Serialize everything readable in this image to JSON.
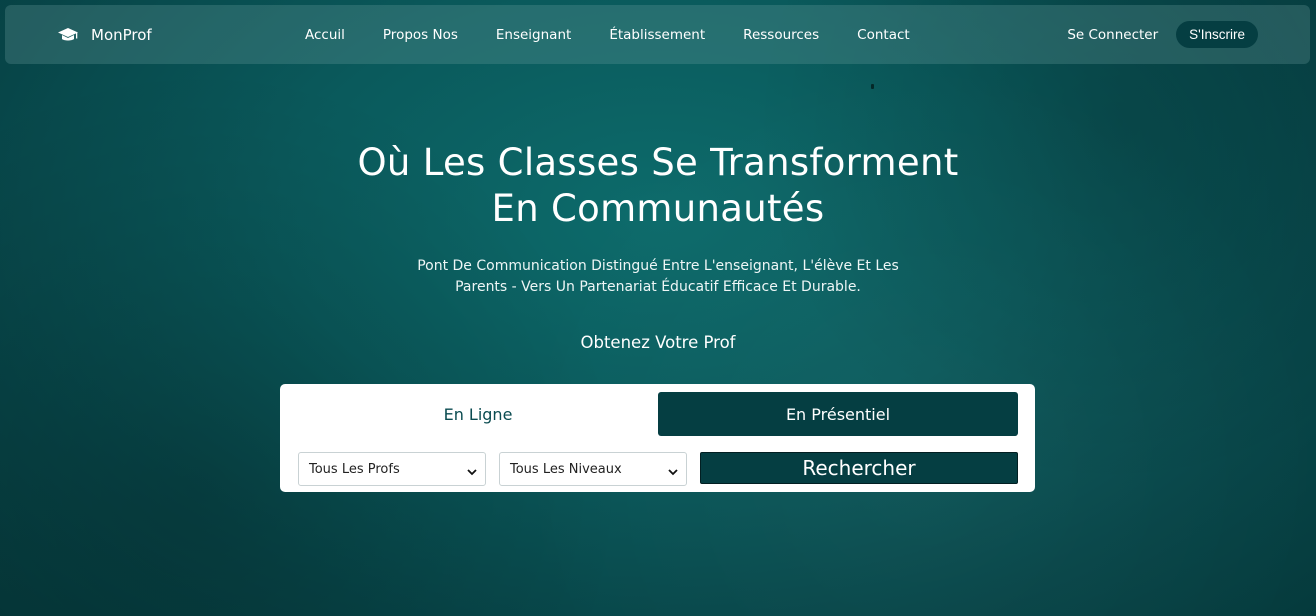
{
  "brand": {
    "name": "MonProf",
    "icon": "graduation-cap-icon"
  },
  "nav": {
    "links": [
      "Accuil",
      "Propos Nos",
      "Enseignant",
      "Établissement",
      "Ressources",
      "Contact"
    ],
    "login_label": "Se Connecter",
    "signup_label": "S'Inscrire"
  },
  "hero": {
    "title_line1": "Où Les Classes Se Transforment",
    "title_line2": "En Communautés",
    "subtitle_line1": "Pont De Communication Distingué Entre L'enseignant, L'élève Et Les",
    "subtitle_line2": "Parents - Vers Un Partenariat Éducatif Efficace Et Durable.",
    "cta_label": "Obtenez Votre Prof"
  },
  "search": {
    "tabs": [
      "En Ligne",
      "En Présentiel"
    ],
    "active_tab": "En Présentiel",
    "profs_select": "Tous Les Profs",
    "levels_select": "Tous Les Niveaux",
    "button_label": "Rechercher"
  },
  "colors": {
    "background": "#0a5a5c",
    "primary_dark": "#053e42",
    "card": "#ffffff"
  }
}
